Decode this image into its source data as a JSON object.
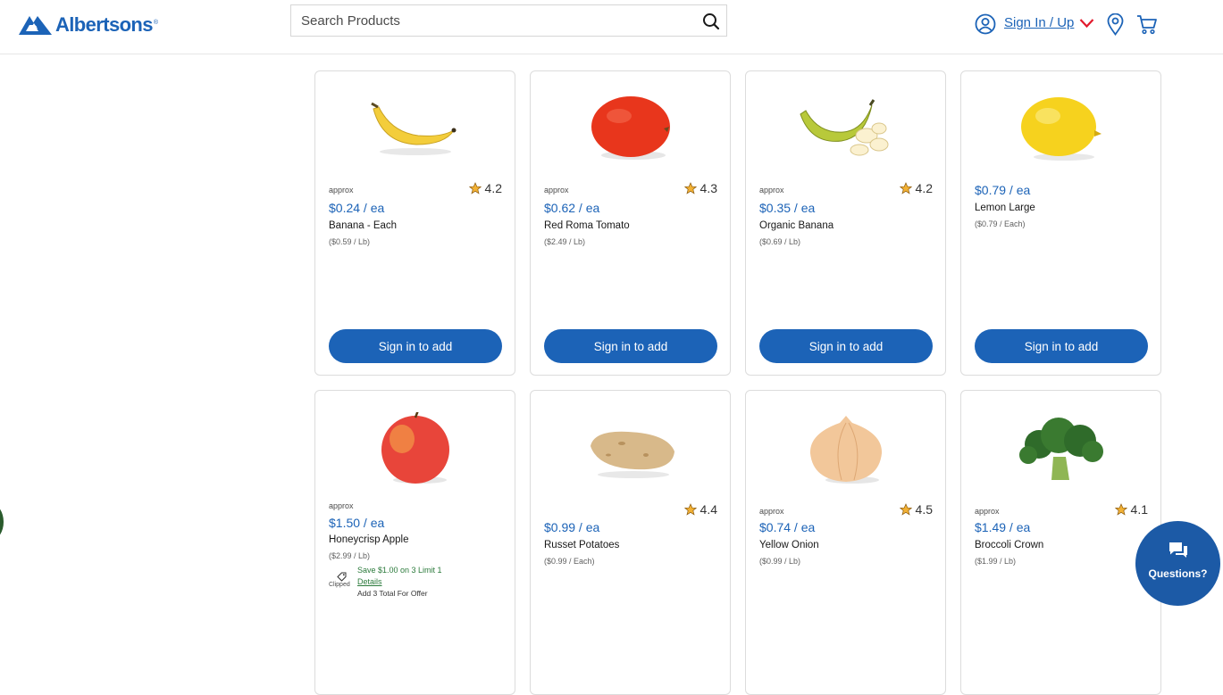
{
  "brand": {
    "name": "Albertsons",
    "color": "#1c63b7"
  },
  "header": {
    "search": {
      "placeholder": "Search Products",
      "icon": "search-icon"
    },
    "account": {
      "signin_label": "Sign In / Up",
      "icons": [
        "account-icon",
        "chevron-down-icon",
        "location-pin-icon",
        "cart-icon"
      ]
    }
  },
  "products": [
    {
      "name": "Banana - Each",
      "approx": "approx",
      "price": "$0.24 / ea",
      "unit_price": "($0.59 / Lb)",
      "rating": "4.2",
      "image": "banana",
      "button": "Sign in to add"
    },
    {
      "name": "Red Roma Tomato",
      "approx": "approx",
      "price": "$0.62 / ea",
      "unit_price": "($2.49 / Lb)",
      "rating": "4.3",
      "image": "tomato",
      "button": "Sign in to add"
    },
    {
      "name": "Organic Banana",
      "approx": "approx",
      "price": "$0.35 / ea",
      "unit_price": "($0.69 / Lb)",
      "rating": "4.2",
      "image": "organic-banana",
      "button": "Sign in to add"
    },
    {
      "name": "Lemon Large",
      "price": "$0.79 / ea",
      "unit_price": "($0.79 / Each)",
      "image": "lemon",
      "button": "Sign in to add"
    },
    {
      "name": "Honeycrisp Apple",
      "approx": "approx",
      "price": "$1.50 / ea",
      "unit_price": "($2.99 / Lb)",
      "image": "apple",
      "offer": {
        "clipped": "Clipped",
        "text": "Save $1.00 on 3 Limit 1",
        "details": "Details",
        "note": "Add 3 Total For Offer"
      }
    },
    {
      "name": "Russet Potatoes",
      "price": "$0.99 / ea",
      "unit_price": "($0.99 / Each)",
      "rating": "4.4",
      "image": "potato"
    },
    {
      "name": "Yellow Onion",
      "approx": "approx",
      "price": "$0.74 / ea",
      "unit_price": "($0.99 / Lb)",
      "rating": "4.5",
      "image": "onion"
    },
    {
      "name": "Broccoli Crown",
      "approx": "approx",
      "price": "$1.49 / ea",
      "unit_price": "($1.99 / Lb)",
      "rating": "4.1",
      "image": "broccoli"
    }
  ],
  "chat": {
    "label": "Questions?",
    "icon": "chat-bubble-icon"
  },
  "colors": {
    "accent": "#1c63b7",
    "offer": "#2b7a3b",
    "star": "#f2b134"
  }
}
